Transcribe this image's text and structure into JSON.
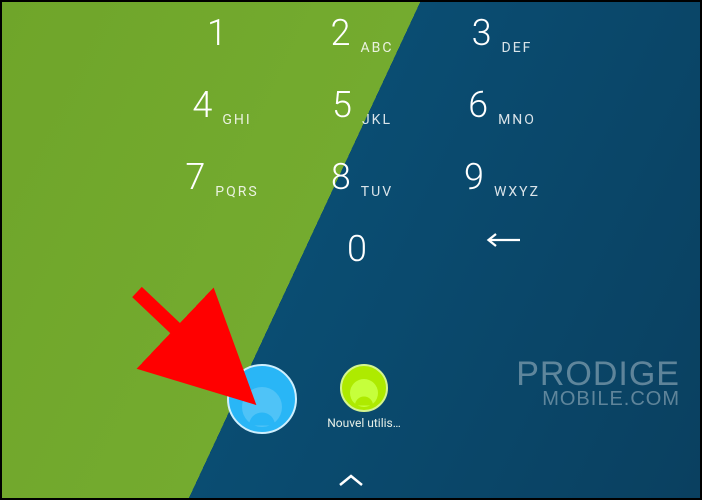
{
  "keypad": {
    "rows": [
      [
        {
          "digit": "1",
          "letters": ""
        },
        {
          "digit": "2",
          "letters": "ABC"
        },
        {
          "digit": "3",
          "letters": "DEF"
        }
      ],
      [
        {
          "digit": "4",
          "letters": "GHI"
        },
        {
          "digit": "5",
          "letters": "JKL"
        },
        {
          "digit": "6",
          "letters": "MNO"
        }
      ],
      [
        {
          "digit": "7",
          "letters": "PQRS"
        },
        {
          "digit": "8",
          "letters": "TUV"
        },
        {
          "digit": "9",
          "letters": "WXYZ"
        }
      ],
      [
        {
          "blank": true
        },
        {
          "digit": "0",
          "letters": ""
        },
        {
          "backspace": true
        }
      ]
    ]
  },
  "users": {
    "main": {
      "label": ""
    },
    "new": {
      "label": "Nouvel utilis…"
    }
  },
  "watermark": {
    "line1": "PRODIGE",
    "line2": "MOBILE.COM"
  },
  "annotation": {
    "arrow_color": "#ff0000"
  }
}
